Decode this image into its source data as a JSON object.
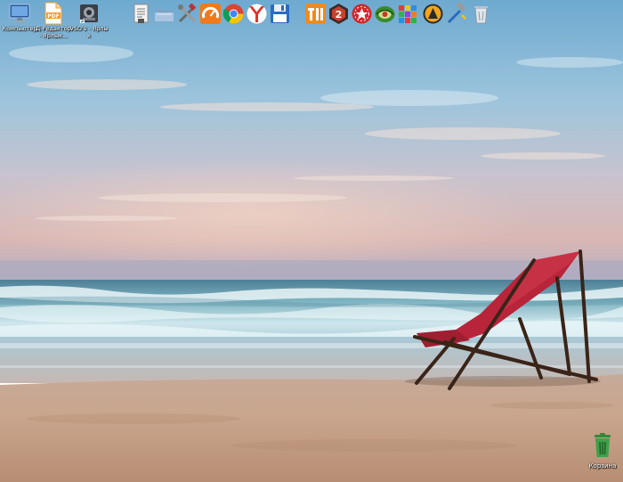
{
  "desktop_icons": [
    {
      "label": "Компьютер",
      "icon": "computer-icon"
    },
    {
      "label": "Д-Редактор - Ярлык...",
      "icon": "pdf-icon"
    },
    {
      "label": "VSO's - Ярлык",
      "icon": "vso-icon"
    }
  ],
  "dock_icons": [
    "document-icon",
    "folder-icon",
    "tools-icon",
    "speedometer-icon",
    "chrome-icon",
    "yandex-browser-icon",
    "floppy-disk-icon",
    "total-commander-icon",
    "second-app-icon",
    "poker-icon",
    "game-icon",
    "color-grid-icon",
    "aimp-icon",
    "hammer-tool-icon",
    "recycle-bin-small-icon"
  ],
  "recycle_bin": {
    "label": "Корзина",
    "icon": "trash-can-icon"
  },
  "colors": {
    "sky_top": "#7fb6d6",
    "sky_horizon": "#c8b9c4",
    "sea": "#6ba5b5",
    "sand": "#c9a58d",
    "chair_fabric": "#b8243a",
    "chair_frame": "#3a2418"
  }
}
